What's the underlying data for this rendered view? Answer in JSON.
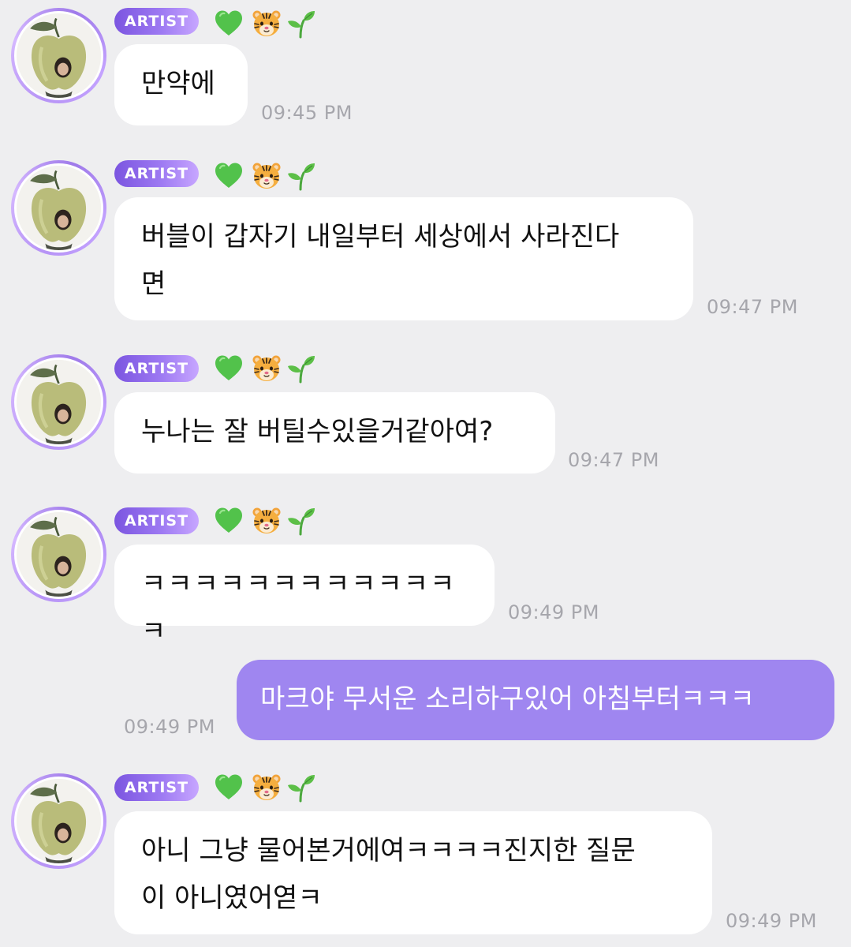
{
  "artist_badge_label": "ARTIST",
  "badge_emojis": [
    "green-heart-icon",
    "tiger-face-icon",
    "seedling-icon"
  ],
  "messages": [
    {
      "from": "artist",
      "text": "만약에",
      "time": "09:45 PM"
    },
    {
      "from": "artist",
      "text": "버블이 갑자기 내일부터 세상에서 사라진다\n면",
      "time": "09:47 PM"
    },
    {
      "from": "artist",
      "text": "누나는 잘 버틸수있을거같아여?",
      "time": "09:47 PM"
    },
    {
      "from": "artist",
      "text": "ㅋㅋㅋㅋㅋㅋㅋㅋㅋㅋㅋㅋㅋ",
      "time": "09:49 PM"
    },
    {
      "from": "me",
      "text": "마크야 무서운 소리하구있어 아침부터ㅋㅋㅋ",
      "time": "09:49 PM"
    },
    {
      "from": "artist",
      "text": "아니 그냥 물어본거에여ㅋㅋㅋㅋ진지한 질문\n이 아니였어엳ㅋ",
      "time": "09:49 PM"
    }
  ],
  "colors": {
    "background": "#EEEEF0",
    "artist_bubble": "#FFFFFF",
    "my_bubble": "#9F86F0",
    "badge_start": "#7B55E0",
    "badge_end": "#C7A6FF",
    "timestamp": "#A6A6AC"
  }
}
